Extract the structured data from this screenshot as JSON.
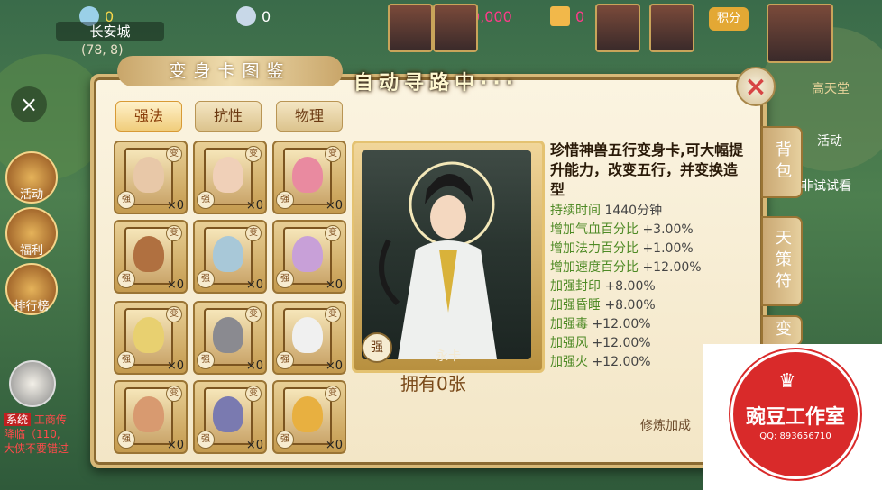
{
  "hud": {
    "vip_count": "0",
    "silver_count": "0",
    "gold_count": "100,000,000",
    "card_count": "0",
    "points_label": "积分",
    "city": "长安城",
    "coords": "(78, 8)"
  },
  "side_left": {
    "activity": "活动",
    "welfare": "福利",
    "rank": "排行榜"
  },
  "panel": {
    "title": "变身卡图鉴",
    "auto_path": "自动寻路中···",
    "tabs": [
      {
        "label": "强法",
        "active": true
      },
      {
        "label": "抗性",
        "active": false
      },
      {
        "label": "物理",
        "active": false
      }
    ],
    "cards": [
      {
        "count": "×0",
        "badge": "变",
        "mark": "强",
        "face": "#e8c8a8"
      },
      {
        "count": "×0",
        "badge": "变",
        "mark": "强",
        "face": "#f0d0b8"
      },
      {
        "count": "×0",
        "badge": "变",
        "mark": "强",
        "face": "#e98aa0"
      },
      {
        "count": "×0",
        "badge": "变",
        "mark": "强",
        "face": "#b07040"
      },
      {
        "count": "×0",
        "badge": "变",
        "mark": "强",
        "face": "#a8c8d8"
      },
      {
        "count": "×0",
        "badge": "变",
        "mark": "强",
        "face": "#c8a0d8"
      },
      {
        "count": "×0",
        "badge": "变",
        "mark": "强",
        "face": "#e8d070"
      },
      {
        "count": "×0",
        "badge": "变",
        "mark": "强",
        "face": "#8a8a90"
      },
      {
        "count": "×0",
        "badge": "变",
        "mark": "强",
        "face": "#f0f0f0"
      },
      {
        "count": "×0",
        "badge": "变",
        "mark": "强",
        "face": "#d89a70"
      },
      {
        "count": "×0",
        "badge": "变",
        "mark": "强",
        "face": "#7a7ab0"
      },
      {
        "count": "×0",
        "badge": "变",
        "mark": "强",
        "face": "#e8b040"
      }
    ],
    "selected": {
      "name": "永卡",
      "mark": "强",
      "owned": "拥有0张",
      "title": "珍惜神兽五行变身卡,可大幅提升能力，改变五行，并变换造型",
      "stats": [
        {
          "label": "持续时间",
          "value": "1440分钟"
        },
        {
          "label": "增加气血百分比",
          "value": "+3.00%"
        },
        {
          "label": "增加法力百分比",
          "value": "+1.00%"
        },
        {
          "label": "增加速度百分比",
          "value": "+12.00%"
        },
        {
          "label": "加强封印",
          "value": "+8.00%"
        },
        {
          "label": "加强昏睡",
          "value": "+8.00%"
        },
        {
          "label": "加强毒",
          "value": "+12.00%"
        },
        {
          "label": "加强风",
          "value": "+12.00%"
        },
        {
          "label": "加强火",
          "value": "+12.00%"
        }
      ]
    },
    "refine_label": "修炼加成"
  },
  "side_right": {
    "bag": "背包",
    "strategy": "天策符",
    "change": "变",
    "activity": "活动",
    "try_text": "非试试看",
    "title_text": "高天堂"
  },
  "chat": {
    "channel": "系统",
    "line1": "工商传",
    "line2": "降临（110,",
    "line3": "大侠不要错过"
  },
  "watermark": {
    "name": "豌豆工作室",
    "qq": "QQ: 893656710"
  },
  "colors": {
    "accent": "#d7b877",
    "green_stat": "#4e8a25",
    "watermark_red": "#d92a2a"
  }
}
